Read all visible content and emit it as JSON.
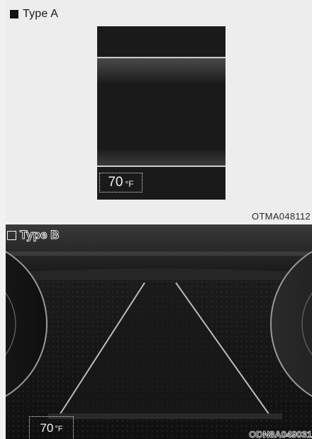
{
  "type_a": {
    "label": "Type A",
    "temperature": {
      "value": "70",
      "unit": "°F"
    },
    "image_code": "OTMA048112"
  },
  "type_b": {
    "label": "Type B",
    "temperature": {
      "value": "70",
      "unit": "°F"
    },
    "image_code": "ODN8A049031"
  },
  "icons": {
    "type_a_marker": "filled-square-icon",
    "type_b_marker": "empty-square-icon"
  },
  "colors": {
    "cluster_background": "#1b1a1a",
    "display_text": "#f2f2f2",
    "page_background": "#f1f1f1"
  }
}
